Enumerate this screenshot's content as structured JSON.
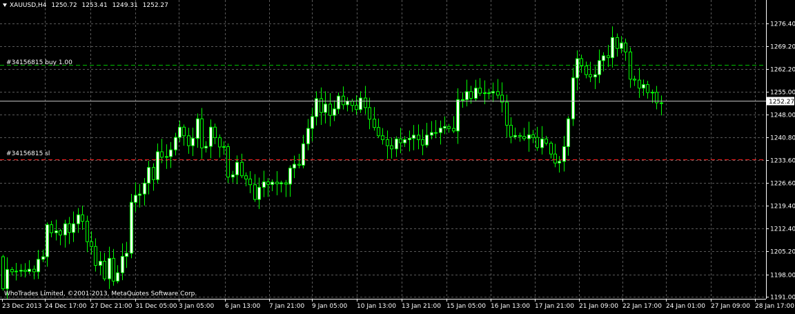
{
  "window": {
    "symbol_timeframe": "XAUUSD,H4",
    "open": "1250.72",
    "high": "1253.41",
    "low": "1249.31",
    "close": "1252.27"
  },
  "order_lines": {
    "buy_label": "#34156815 buy 1.00",
    "sl_label": "#34156815 sl",
    "buy_price": 1263.5,
    "sl_price": 1234.0,
    "buy_color": "#00c000",
    "sl_color": "#ff2020"
  },
  "bid_line": {
    "label": "1252.27",
    "price": 1252.27
  },
  "copyright": "WhoTrades Limited, ©2001-2013, MetaQuotes Software Corp.",
  "colors": {
    "background": "#000000",
    "grid": "#5a5a5a",
    "bull_body": "#ffffff",
    "bear_body": "#000000",
    "wick": "#00ff00",
    "axis_text": "#ffffff"
  },
  "chart_data": {
    "type": "candlestick",
    "symbol": "XAUUSD",
    "timeframe": "H4",
    "y_ticks": [
      "1276.40",
      "1269.20",
      "1262.20",
      "1255.00",
      "1248.00",
      "1240.80",
      "1233.60",
      "1226.60",
      "1219.40",
      "1212.40",
      "1205.20",
      "1198.00",
      "1191.00"
    ],
    "ylim": [
      1189.0,
      1280.0
    ],
    "x_ticks": [
      "23 Dec 2013",
      "24 Dec 17:00",
      "27 Dec 21:00",
      "31 Dec 05:00",
      "3 Jan 05:00",
      "6 Jan 13:00",
      "7 Jan 21:00",
      "9 Jan 05:00",
      "10 Jan 13:00",
      "13 Jan 21:00",
      "15 Jan 05:00",
      "16 Jan 13:00",
      "17 Jan 21:00",
      "21 Jan 09:00",
      "22 Jan 17:00",
      "24 Jan 01:00",
      "27 Jan 09:00",
      "28 Jan 17:00"
    ],
    "closes": [
      1193.5,
      1199.5,
      1198.8,
      1199.0,
      1199.3,
      1198.9,
      1199.6,
      1198.8,
      1202.7,
      1203.5,
      1213.5,
      1211.0,
      1211.6,
      1210.3,
      1213.8,
      1211.1,
      1213.8,
      1216.6,
      1214.6,
      1208.2,
      1206.7,
      1200.8,
      1202.1,
      1196.6,
      1203.0,
      1195.9,
      1198.5,
      1203.6,
      1204.6,
      1220.5,
      1222.7,
      1223.1,
      1226.5,
      1231.4,
      1227.6,
      1236.3,
      1234.6,
      1234.8,
      1236.9,
      1240.8,
      1244.0,
      1241.3,
      1238.2,
      1240.5,
      1246.6,
      1237.5,
      1238.0,
      1244.0,
      1240.7,
      1237.8,
      1237.9,
      1228.4,
      1229.1,
      1233.0,
      1228.8,
      1227.8,
      1226.0,
      1221.4,
      1225.2,
      1226.9,
      1226.1,
      1226.8,
      1226.3,
      1226.6,
      1226.2,
      1231.2,
      1232.4,
      1232.1,
      1238.8,
      1243.6,
      1247.3,
      1252.9,
      1248.6,
      1251.2,
      1247.7,
      1249.7,
      1253.7,
      1251.0,
      1252.1,
      1250.8,
      1249.5,
      1253.1,
      1250.1,
      1246.5,
      1243.9,
      1241.3,
      1240.1,
      1238.2,
      1237.2,
      1240.3,
      1239.1,
      1240.1,
      1240.5,
      1241.5,
      1240.1,
      1238.4,
      1241.5,
      1242.3,
      1242.3,
      1243.7,
      1244.2,
      1243.6,
      1242.8,
      1252.6,
      1252.6,
      1255.1,
      1253.0,
      1256.2,
      1254.6,
      1254.7,
      1254.7,
      1255.1,
      1254.0,
      1251.8,
      1244.6,
      1241.0,
      1241.4,
      1241.1,
      1240.4,
      1241.6,
      1240.8,
      1237.6,
      1240.3,
      1239.0,
      1235.6,
      1232.8,
      1233.3,
      1237.9,
      1246.6,
      1259.4,
      1265.4,
      1263.1,
      1260.4,
      1259.7,
      1260.4,
      1264.8,
      1266.3,
      1265.7,
      1272.0,
      1268.6,
      1270.3,
      1267.5,
      1259.0,
      1258.7,
      1256.2,
      1257.3,
      1254.8,
      1254.9,
      1251.6,
      1251.6
    ]
  }
}
